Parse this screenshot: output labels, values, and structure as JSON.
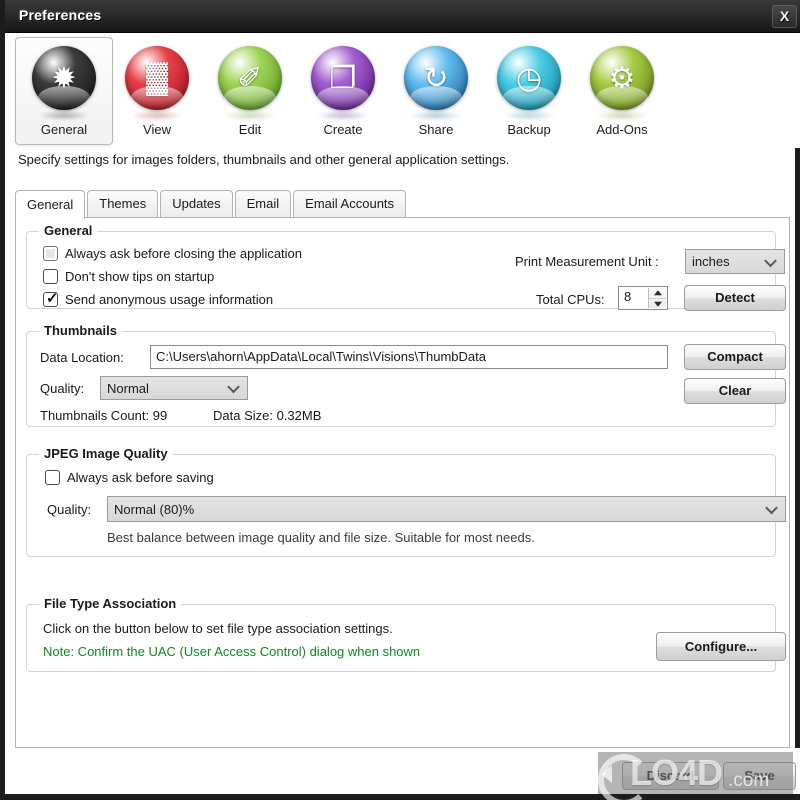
{
  "window": {
    "title": "Preferences",
    "close_label": "X"
  },
  "toolbar": {
    "items": [
      {
        "label": "General",
        "icon": "general-gear-icon",
        "color": "#3c3c3c",
        "color2": "#111111",
        "selected": true,
        "glyph": "✹"
      },
      {
        "label": "View",
        "icon": "view-filmstrip-icon",
        "color": "#e8404a",
        "color2": "#9c0f18",
        "selected": false,
        "glyph": "▓"
      },
      {
        "label": "Edit",
        "icon": "edit-brush-icon",
        "color": "#9ed455",
        "color2": "#4f8e18",
        "selected": false,
        "glyph": "✐"
      },
      {
        "label": "Create",
        "icon": "create-page-icon",
        "color": "#a15fd0",
        "color2": "#551288",
        "selected": false,
        "glyph": "❐"
      },
      {
        "label": "Share",
        "icon": "share-arrows-icon",
        "color": "#62bdf0",
        "color2": "#0f5a92",
        "selected": false,
        "glyph": "↻"
      },
      {
        "label": "Backup",
        "icon": "backup-clock-icon",
        "color": "#49cde4",
        "color2": "#0c7f9b",
        "selected": false,
        "glyph": "◷"
      },
      {
        "label": "Add-Ons",
        "icon": "addons-gears-icon",
        "color": "#a8cb45",
        "color2": "#5d7f0f",
        "selected": false,
        "glyph": "⚙"
      }
    ]
  },
  "description": "Specify settings for images folders, thumbnails and other general application settings.",
  "tabs": [
    {
      "label": "General",
      "active": true
    },
    {
      "label": "Themes",
      "active": false
    },
    {
      "label": "Updates",
      "active": false
    },
    {
      "label": "Email",
      "active": false
    },
    {
      "label": "Email Accounts",
      "active": false
    }
  ],
  "general_group": {
    "title": "General",
    "checkboxes": [
      {
        "label": "Always ask before closing the application",
        "checked": false,
        "hovered": true
      },
      {
        "label": "Don't show tips on startup",
        "checked": false,
        "hovered": false
      },
      {
        "label": "Send anonymous usage information",
        "checked": true,
        "hovered": false
      }
    ],
    "print_unit_label": "Print Measurement Unit :",
    "print_unit_value": "inches",
    "total_cpus_label": "Total CPUs:",
    "total_cpus_value": "8",
    "detect_label": "Detect"
  },
  "thumbnails_group": {
    "title": "Thumbnails",
    "data_location_label": "Data Location:",
    "data_location_value": "C:\\Users\\ahorn\\AppData\\Local\\Twins\\Visions\\ThumbData",
    "quality_label": "Quality:",
    "quality_value": "Normal",
    "count_text": "Thumbnails Count: 99",
    "size_text": "Data Size: 0.32MB",
    "compact_label": "Compact",
    "clear_label": "Clear"
  },
  "jpeg_group": {
    "title": "JPEG Image Quality",
    "always_ask_label": "Always ask before saving",
    "always_ask_checked": false,
    "quality_label": "Quality:",
    "quality_value": "Normal (80)%",
    "hint": "Best balance between image quality and file size. Suitable for most needs."
  },
  "filetype_group": {
    "title": "File Type Association",
    "line1": "Click on the button below to set file type association settings.",
    "note": "Note: Confirm the UAC (User Access Control) dialog when shown",
    "note_color": "#0d8b20",
    "configure_label": "Configure..."
  },
  "footer": {
    "discard_label": "Discard",
    "save_label": "Save"
  },
  "watermark": {
    "text": "LO4D",
    "suffix": ".com"
  }
}
